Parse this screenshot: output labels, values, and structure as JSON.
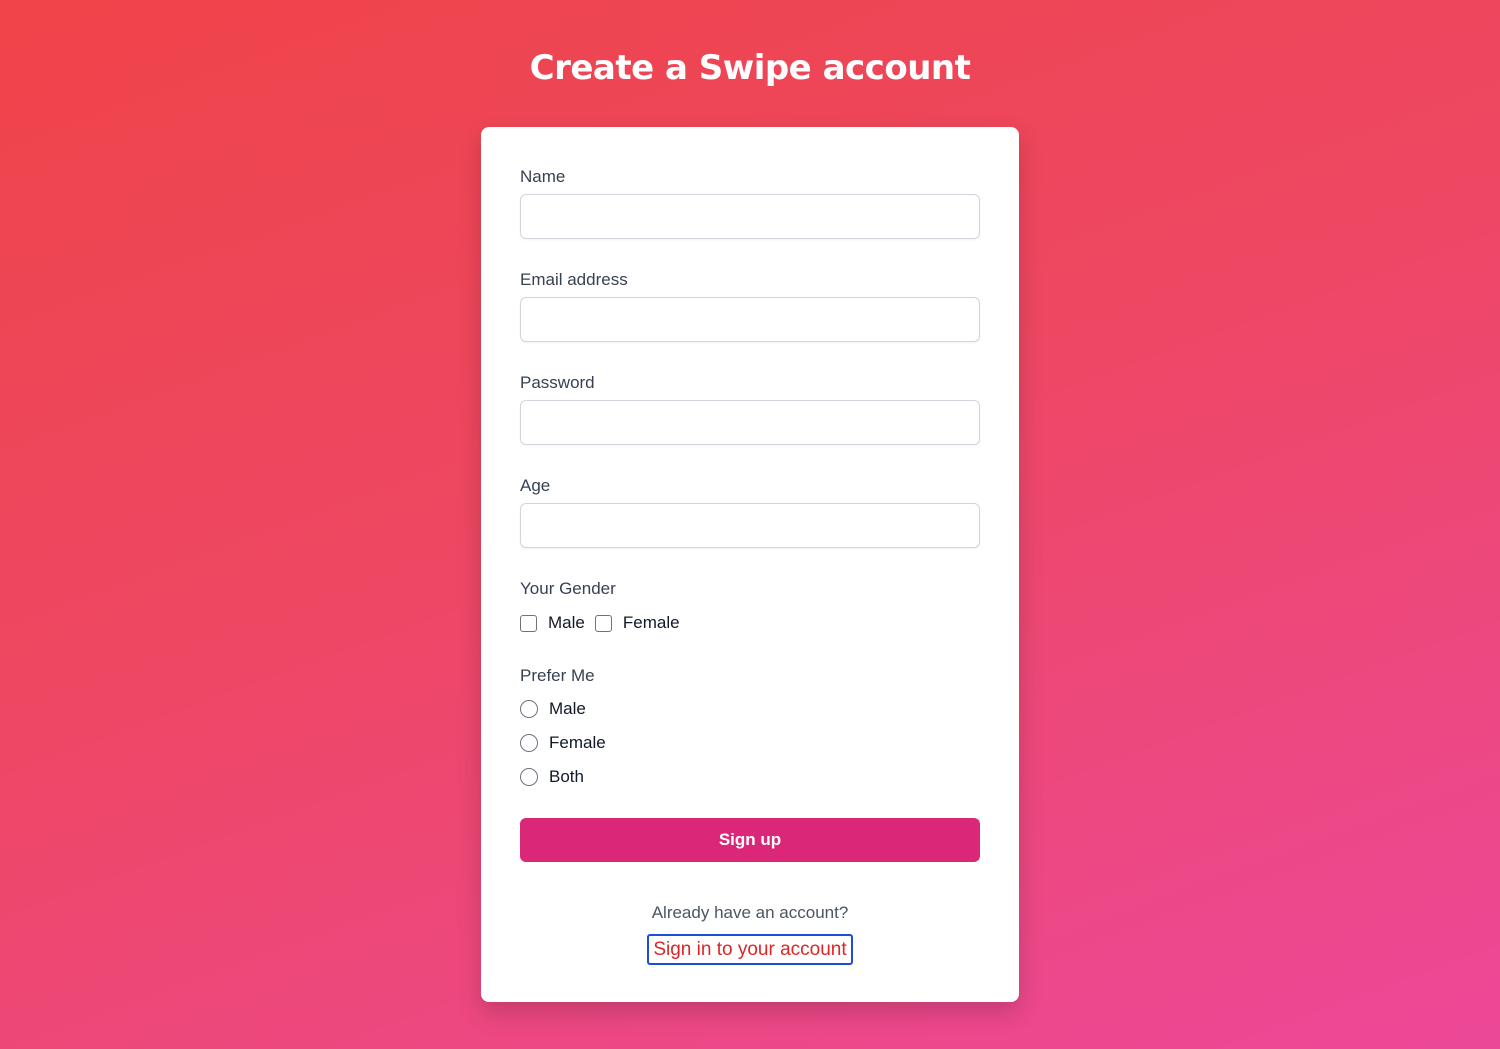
{
  "page": {
    "title": "Create a Swipe account"
  },
  "form": {
    "name_label": "Name",
    "name_value": "",
    "email_label": "Email address",
    "email_value": "",
    "password_label": "Password",
    "password_value": "",
    "age_label": "Age",
    "age_value": "",
    "gender": {
      "label": "Your Gender",
      "options": [
        "Male",
        "Female"
      ]
    },
    "prefer": {
      "label": "Prefer Me",
      "options": [
        "Male",
        "Female",
        "Both"
      ]
    },
    "submit_label": "Sign up"
  },
  "footer": {
    "prompt": "Already have an account?",
    "signin_link": "Sign in to your account"
  },
  "colors": {
    "button": "#db2777",
    "link": "#dc2626",
    "background_start": "#ef4449",
    "background_end": "#ec4899"
  }
}
